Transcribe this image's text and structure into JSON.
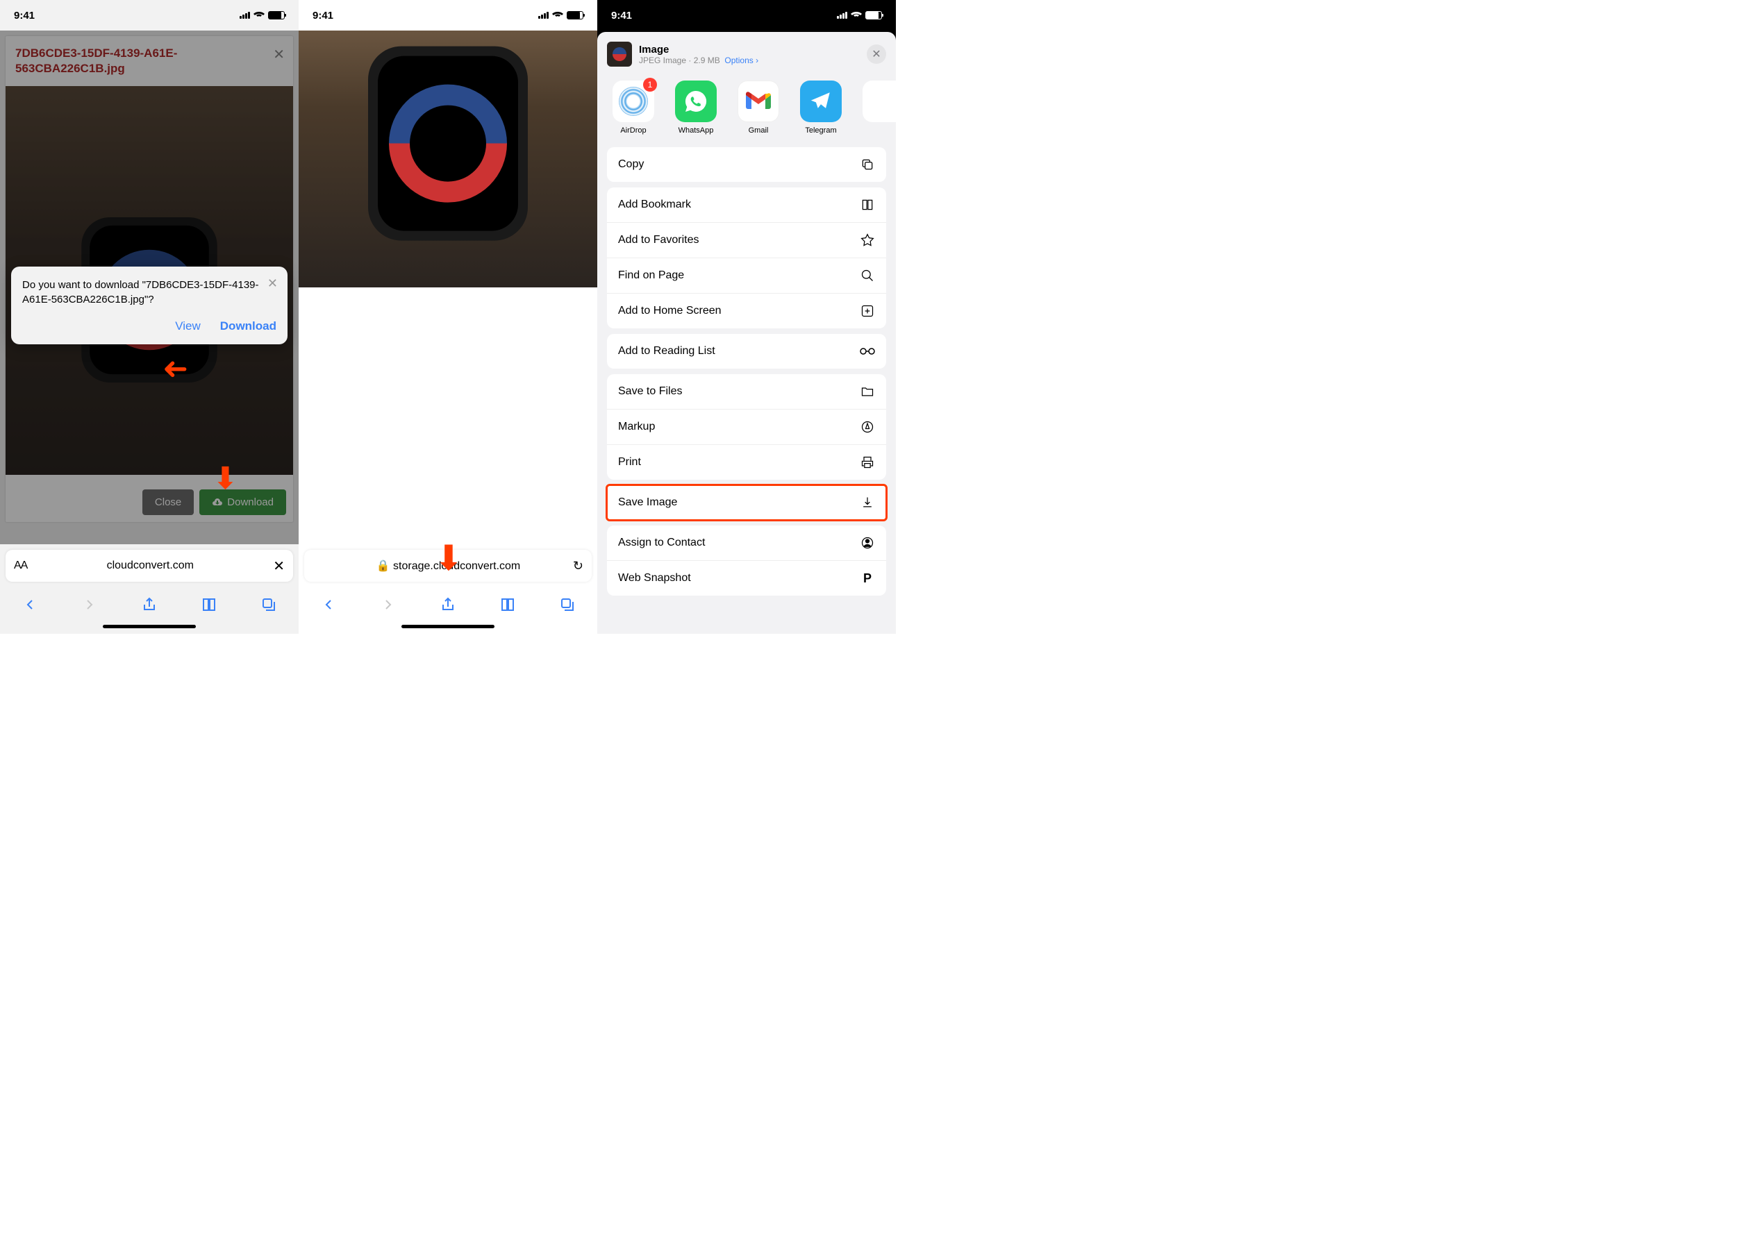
{
  "status": {
    "time": "9:41"
  },
  "screen1": {
    "filename": "7DB6CDE3-15DF-4139-A61E-563CBA226C1B.jpg",
    "dialog_text": "Do you want to download \"7DB6CDE3-15DF-4139-A61E-563CBA226C1B.jpg\"?",
    "view": "View",
    "download": "Download",
    "btn_close": "Close",
    "btn_download": "Download",
    "url": "cloudconvert.com"
  },
  "screen2": {
    "url": "storage.cloudconvert.com"
  },
  "screen3": {
    "header_title": "Image",
    "header_meta": "JPEG Image · 2.9 MB",
    "options": "Options",
    "airdrop_badge": "1",
    "apps": {
      "airdrop": "AirDrop",
      "whatsapp": "WhatsApp",
      "gmail": "Gmail",
      "telegram": "Telegram"
    },
    "actions": {
      "copy": "Copy",
      "add_bookmark": "Add Bookmark",
      "add_favorites": "Add to Favorites",
      "find_page": "Find on Page",
      "add_home": "Add to Home Screen",
      "reading_list": "Add to Reading List",
      "save_files": "Save to Files",
      "markup": "Markup",
      "print": "Print",
      "save_image": "Save Image",
      "assign_contact": "Assign to Contact",
      "web_snapshot": "Web Snapshot"
    }
  }
}
